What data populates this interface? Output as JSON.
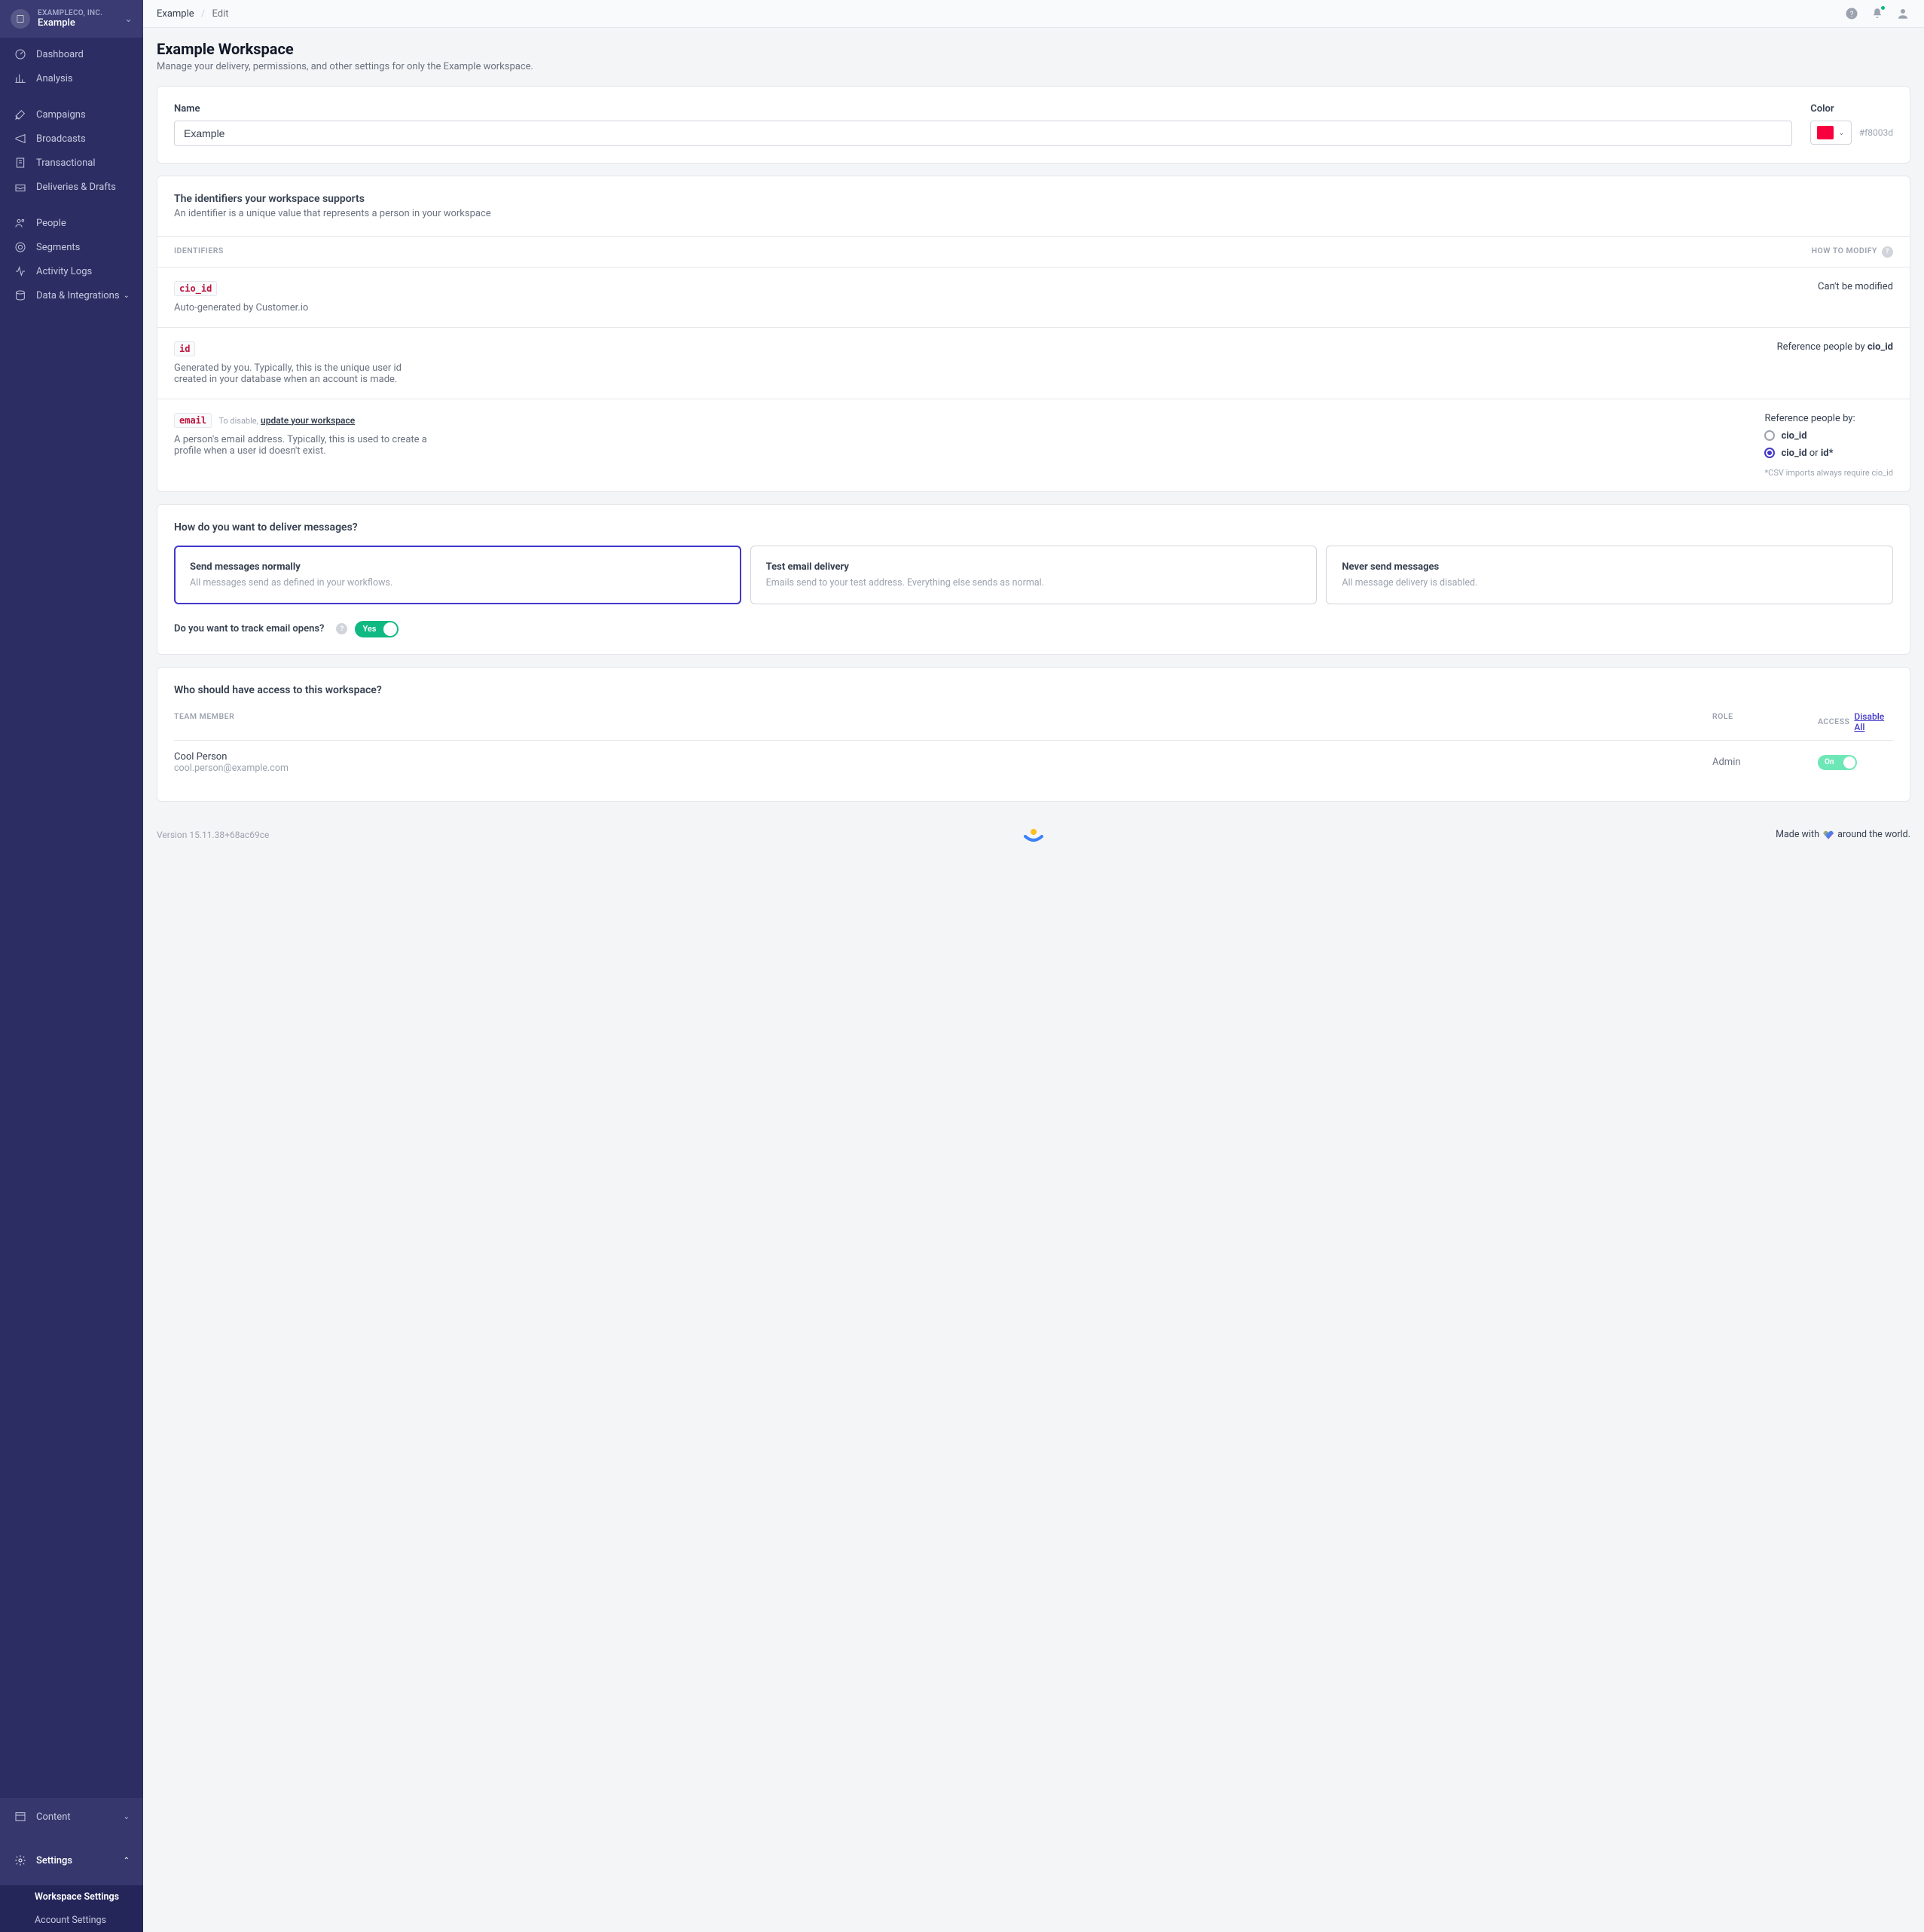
{
  "org": {
    "company": "EXAMPLECO, INC.",
    "workspace": "Example"
  },
  "nav": {
    "dashboard": "Dashboard",
    "analysis": "Analysis",
    "campaigns": "Campaigns",
    "broadcasts": "Broadcasts",
    "transactional": "Transactional",
    "deliveries": "Deliveries & Drafts",
    "people": "People",
    "segments": "Segments",
    "activity": "Activity Logs",
    "data": "Data & Integrations",
    "content": "Content",
    "settings": "Settings",
    "workspace_settings": "Workspace Settings",
    "account_settings": "Account Settings"
  },
  "breadcrumb": {
    "root": "Example",
    "current": "Edit"
  },
  "page": {
    "title": "Example Workspace",
    "subtitle": "Manage your delivery, permissions, and other settings for only the Example workspace."
  },
  "name_section": {
    "name_label": "Name",
    "name_value": "Example",
    "color_label": "Color",
    "color_value": "#f8003d"
  },
  "identifiers": {
    "title": "The identifiers your workspace supports",
    "subtitle": "An identifier is a unique value that represents a person in your workspace",
    "col_ids": "IDENTIFIERS",
    "col_modify": "HOW TO MODIFY",
    "rows": [
      {
        "code": "cio_id",
        "desc": "Auto-generated by Customer.io",
        "right_plain": "Can't be modified"
      },
      {
        "code": "id",
        "desc": "Generated by you. Typically, this is the unique user id created in your database when an account is made.",
        "ref_prefix": "Reference people by ",
        "ref_bold": "cio_id"
      },
      {
        "code": "email",
        "disable_prefix": "To disable,",
        "disable_link": "update your workspace",
        "desc": "A person's email address. Typically, this is used to create a profile when a user id doesn't exist.",
        "ref_title": "Reference people by:",
        "radio1": "cio_id",
        "radio2a": "cio_id",
        "radio2b": " or ",
        "radio2c": "id*",
        "csv_note": "*CSV imports always require cio_id"
      }
    ]
  },
  "delivery": {
    "title": "How do you want to deliver messages?",
    "options": [
      {
        "title": "Send messages normally",
        "desc": "All messages send as defined in your workflows."
      },
      {
        "title": "Test email delivery",
        "desc": "Emails send to your test address. Everything else sends as normal."
      },
      {
        "title": "Never send messages",
        "desc": "All message delivery is disabled."
      }
    ],
    "track_label": "Do you want to track email opens?",
    "toggle_yes": "Yes"
  },
  "access": {
    "title": "Who should have access to this workspace?",
    "col_member": "TEAM MEMBER",
    "col_role": "ROLE",
    "col_access": "ACCESS",
    "disable_all": "Disable All",
    "members": [
      {
        "name": "Cool Person",
        "email": "cool.person@example.com",
        "role": "Admin",
        "toggle": "On"
      }
    ]
  },
  "footer": {
    "version": "Version 15.11.38+68ac69ce",
    "made_prefix": "Made with ",
    "made_suffix": " around the world."
  }
}
